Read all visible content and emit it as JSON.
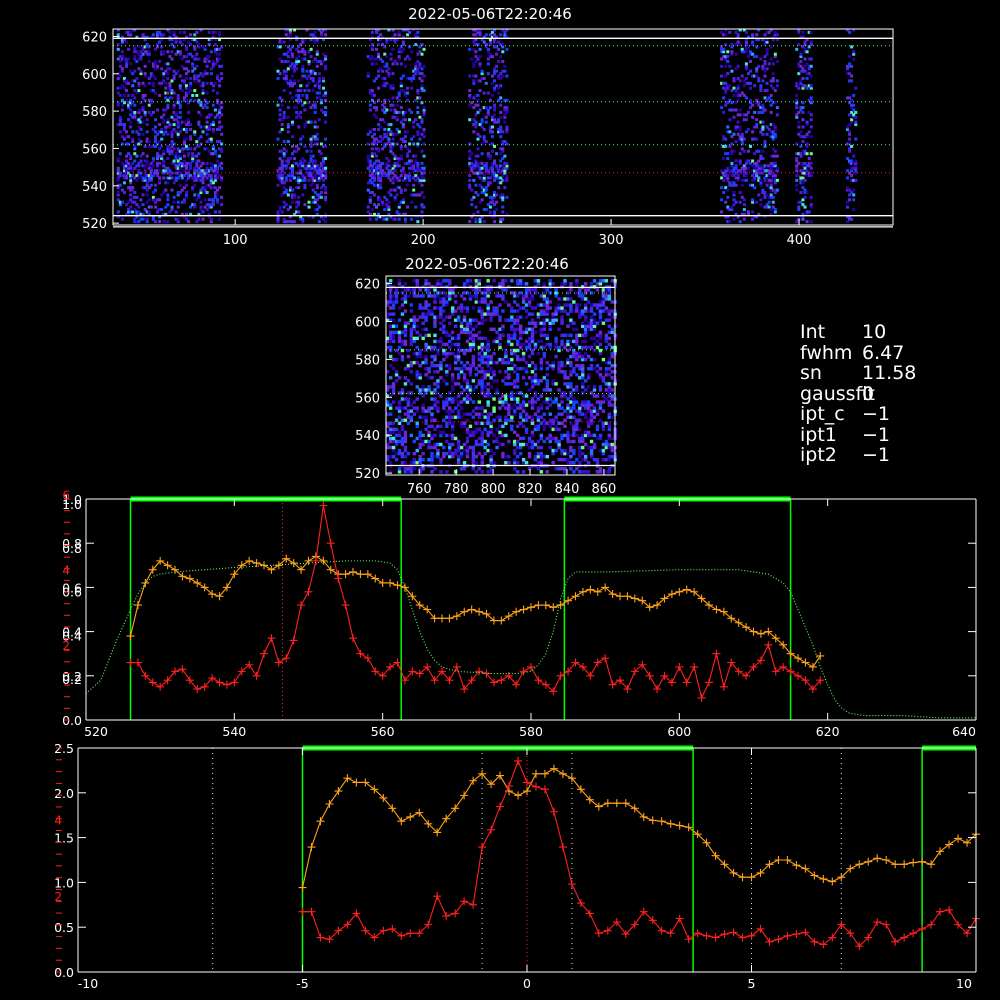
{
  "top_image": {
    "title": "2022-05-06T22:20:46",
    "xlim": [
      35,
      450
    ],
    "ylim": [
      519,
      624
    ],
    "xticks": [
      100,
      200,
      300,
      400
    ],
    "yticks": [
      520,
      540,
      560,
      580,
      600,
      620
    ],
    "hlines_white": [
      518,
      524,
      619
    ],
    "hlines_green": [
      585,
      562,
      615
    ],
    "hline_red": 547,
    "columns": [
      {
        "start": 37,
        "end": 93
      },
      {
        "start": 122,
        "end": 148
      },
      {
        "start": 170,
        "end": 200
      },
      {
        "start": 224,
        "end": 244
      },
      {
        "start": 358,
        "end": 388
      },
      {
        "start": 398,
        "end": 406
      },
      {
        "start": 425,
        "end": 430
      }
    ]
  },
  "zoom_image": {
    "title": "2022-05-06T22:20:46",
    "xlim": [
      742,
      866
    ],
    "ylim": [
      519,
      624
    ],
    "xticks": [
      760,
      780,
      800,
      820,
      840,
      860
    ],
    "yticks": [
      520,
      540,
      560,
      580,
      600,
      620
    ]
  },
  "fit_info": [
    {
      "key": "Int",
      "value": "10"
    },
    {
      "key": "fwhm",
      "value": "6.47"
    },
    {
      "key": "sn",
      "value": "11.58"
    },
    {
      "key": "gaussfit",
      "value": "0"
    },
    {
      "key": "ipt_c",
      "value": "−1"
    },
    {
      "key": "ipt1",
      "value": "−1"
    },
    {
      "key": "ipt2",
      "value": "−1"
    }
  ],
  "colors": {
    "background": "#000000",
    "axes": "#ffffff",
    "green": "#00ff00",
    "orange": "#ffa31a",
    "red": "#ff2020",
    "dotted_white": "#ffffff",
    "dotted_green": "#66ff66"
  },
  "chart_data": [
    {
      "type": "line",
      "panel": "profile",
      "xlim": [
        520,
        640
      ],
      "xticks": [
        520,
        540,
        560,
        580,
        600,
        620,
        640
      ],
      "left_axis_white": {
        "ylim": [
          0,
          1.0
        ],
        "ticks": [
          "0.0",
          "0.2",
          "0.4",
          "0.6",
          "0.8",
          "1.0"
        ]
      },
      "left_axis_white2": {
        "ticks": [
          "0.2",
          "0.4",
          "0.6",
          "0.8",
          "1.0"
        ]
      },
      "left_axis_red": {
        "ticks": [
          "2",
          "4",
          "6"
        ]
      },
      "green_windows": [
        [
          526,
          562.5
        ],
        [
          584.5,
          615
        ]
      ],
      "red_dotted_x": 546.5,
      "series": [
        {
          "color": "orange",
          "x": [
            526,
            527,
            528,
            529,
            530,
            531,
            532,
            533,
            534,
            535,
            536,
            537,
            538,
            539,
            540,
            541,
            542,
            543,
            544,
            545,
            546,
            547,
            548,
            549,
            550,
            551,
            552,
            553,
            554,
            555,
            556,
            557,
            558,
            559,
            560,
            561,
            562,
            563,
            564,
            565,
            566,
            567,
            568,
            569,
            570,
            571,
            572,
            573,
            574,
            575,
            576,
            577,
            578,
            579,
            580,
            581,
            582,
            583,
            584,
            585,
            586,
            587,
            588,
            589,
            590,
            591,
            592,
            593,
            594,
            595,
            596,
            597,
            598,
            599,
            600,
            601,
            602,
            603,
            604,
            605,
            606,
            607,
            608,
            609,
            610,
            611,
            612,
            613,
            614,
            615,
            616,
            617,
            618,
            619
          ],
          "y": [
            0.38,
            0.52,
            0.62,
            0.68,
            0.72,
            0.7,
            0.68,
            0.65,
            0.64,
            0.62,
            0.6,
            0.57,
            0.56,
            0.6,
            0.66,
            0.7,
            0.72,
            0.71,
            0.7,
            0.68,
            0.7,
            0.73,
            0.71,
            0.68,
            0.72,
            0.74,
            0.72,
            0.68,
            0.66,
            0.66,
            0.67,
            0.66,
            0.66,
            0.64,
            0.62,
            0.62,
            0.61,
            0.6,
            0.56,
            0.52,
            0.5,
            0.46,
            0.46,
            0.46,
            0.47,
            0.49,
            0.5,
            0.49,
            0.48,
            0.45,
            0.45,
            0.47,
            0.49,
            0.5,
            0.51,
            0.52,
            0.52,
            0.51,
            0.52,
            0.54,
            0.56,
            0.58,
            0.59,
            0.58,
            0.6,
            0.57,
            0.56,
            0.56,
            0.55,
            0.54,
            0.51,
            0.52,
            0.55,
            0.57,
            0.58,
            0.59,
            0.58,
            0.55,
            0.52,
            0.5,
            0.49,
            0.46,
            0.44,
            0.42,
            0.4,
            0.39,
            0.4,
            0.37,
            0.34,
            0.3,
            0.28,
            0.26,
            0.24,
            0.29
          ]
        },
        {
          "color": "red",
          "x": [
            526,
            527,
            528,
            529,
            530,
            531,
            532,
            533,
            534,
            535,
            536,
            537,
            538,
            539,
            540,
            541,
            542,
            543,
            544,
            545,
            546,
            547,
            548,
            549,
            550,
            551,
            552,
            553,
            554,
            555,
            556,
            557,
            558,
            559,
            560,
            561,
            562,
            563,
            564,
            565,
            566,
            567,
            568,
            569,
            570,
            571,
            572,
            573,
            574,
            575,
            576,
            577,
            578,
            579,
            580,
            581,
            582,
            583,
            584,
            585,
            586,
            587,
            588,
            589,
            590,
            591,
            592,
            593,
            594,
            595,
            596,
            597,
            598,
            599,
            600,
            601,
            602,
            603,
            604,
            605,
            606,
            607,
            608,
            609,
            610,
            611,
            612,
            613,
            614,
            615,
            616,
            617,
            618,
            619
          ],
          "y": [
            0.26,
            0.26,
            0.2,
            0.17,
            0.15,
            0.18,
            0.22,
            0.23,
            0.18,
            0.14,
            0.15,
            0.19,
            0.17,
            0.16,
            0.17,
            0.22,
            0.25,
            0.2,
            0.3,
            0.37,
            0.26,
            0.28,
            0.36,
            0.52,
            0.58,
            0.72,
            0.97,
            0.8,
            0.64,
            0.52,
            0.37,
            0.3,
            0.28,
            0.22,
            0.2,
            0.24,
            0.26,
            0.18,
            0.22,
            0.21,
            0.24,
            0.18,
            0.22,
            0.18,
            0.24,
            0.14,
            0.18,
            0.22,
            0.21,
            0.17,
            0.18,
            0.2,
            0.16,
            0.22,
            0.24,
            0.18,
            0.16,
            0.13,
            0.2,
            0.22,
            0.26,
            0.24,
            0.2,
            0.26,
            0.28,
            0.16,
            0.18,
            0.14,
            0.22,
            0.25,
            0.2,
            0.14,
            0.2,
            0.17,
            0.24,
            0.17,
            0.24,
            0.1,
            0.17,
            0.3,
            0.15,
            0.26,
            0.22,
            0.2,
            0.24,
            0.27,
            0.34,
            0.22,
            0.24,
            0.22,
            0.2,
            0.18,
            0.14,
            0.18
          ]
        },
        {
          "color": "dotted_green",
          "style": "dotted",
          "x": [
            520,
            522,
            524,
            526,
            527,
            528,
            529,
            530,
            532,
            540,
            545,
            550,
            555,
            559,
            561,
            562,
            563,
            564,
            565,
            566,
            567,
            568,
            570,
            575,
            578,
            580,
            581,
            582,
            583,
            584,
            585,
            586,
            590,
            600,
            608,
            612,
            614,
            615,
            616,
            617,
            618,
            619,
            620,
            621,
            622,
            623,
            625,
            630,
            635,
            640
          ],
          "y": [
            0.12,
            0.18,
            0.35,
            0.5,
            0.57,
            0.62,
            0.65,
            0.66,
            0.67,
            0.69,
            0.7,
            0.71,
            0.72,
            0.72,
            0.71,
            0.68,
            0.6,
            0.5,
            0.4,
            0.32,
            0.27,
            0.24,
            0.22,
            0.21,
            0.21,
            0.22,
            0.25,
            0.3,
            0.4,
            0.55,
            0.64,
            0.67,
            0.67,
            0.68,
            0.68,
            0.66,
            0.62,
            0.58,
            0.5,
            0.42,
            0.34,
            0.24,
            0.16,
            0.09,
            0.05,
            0.03,
            0.02,
            0.02,
            0.01,
            0.01
          ]
        }
      ]
    },
    {
      "type": "line",
      "panel": "offset",
      "xlim": [
        -10,
        10
      ],
      "xticks": [
        -10,
        -5,
        0,
        5,
        10
      ],
      "left_axis_white": {
        "ylim": [
          0,
          2.6
        ],
        "ticks": [
          "0.0",
          "0.5",
          "1.0",
          "1.5",
          "2.0",
          "2.5"
        ]
      },
      "left_axis_red": {
        "ticks": [
          "2",
          "4"
        ]
      },
      "green_windows": [
        [
          -5,
          3.7
        ],
        [
          8.8,
          10
        ]
      ],
      "dotted_white_x": [
        -7,
        -1,
        1,
        5,
        7
      ],
      "red_dotted_x": 0,
      "series": [
        {
          "color": "orange",
          "x": [
            -5.0,
            -4.8,
            -4.6,
            -4.4,
            -4.2,
            -4.0,
            -3.8,
            -3.6,
            -3.4,
            -3.2,
            -3.0,
            -2.8,
            -2.6,
            -2.4,
            -2.2,
            -2.0,
            -1.8,
            -1.6,
            -1.4,
            -1.2,
            -1.0,
            -0.8,
            -0.6,
            -0.4,
            -0.2,
            0.0,
            0.2,
            0.4,
            0.6,
            0.8,
            1.0,
            1.2,
            1.4,
            1.6,
            1.8,
            2.0,
            2.2,
            2.4,
            2.6,
            2.8,
            3.0,
            3.2,
            3.4,
            3.6,
            3.8,
            4.0,
            4.2,
            4.4,
            4.6,
            4.8,
            5.0,
            5.2,
            5.4,
            5.6,
            5.8,
            6.0,
            6.2,
            6.4,
            6.6,
            6.8,
            7.0,
            7.2,
            7.4,
            7.6,
            7.8,
            8.0,
            8.2,
            8.4,
            8.6,
            8.8,
            9.0,
            9.2,
            9.4,
            9.6,
            9.8,
            10.0
          ],
          "y": [
            0.98,
            1.45,
            1.75,
            1.95,
            2.1,
            2.25,
            2.2,
            2.2,
            2.12,
            2.02,
            1.9,
            1.75,
            1.8,
            1.85,
            1.72,
            1.62,
            1.78,
            1.9,
            2.05,
            2.22,
            2.3,
            2.18,
            2.28,
            2.1,
            2.05,
            2.1,
            2.3,
            2.3,
            2.36,
            2.3,
            2.25,
            2.12,
            2.0,
            1.92,
            1.96,
            1.96,
            1.96,
            1.9,
            1.8,
            1.76,
            1.75,
            1.72,
            1.7,
            1.68,
            1.6,
            1.5,
            1.35,
            1.25,
            1.15,
            1.1,
            1.1,
            1.15,
            1.25,
            1.3,
            1.3,
            1.24,
            1.2,
            1.12,
            1.08,
            1.05,
            1.1,
            1.2,
            1.25,
            1.28,
            1.32,
            1.3,
            1.25,
            1.25,
            1.27,
            1.28,
            1.25,
            1.4,
            1.48,
            1.55,
            1.5,
            1.6
          ]
        },
        {
          "color": "red",
          "x": [
            -5.0,
            -4.8,
            -4.6,
            -4.4,
            -4.2,
            -4.0,
            -3.8,
            -3.6,
            -3.4,
            -3.2,
            -3.0,
            -2.8,
            -2.6,
            -2.4,
            -2.2,
            -2.0,
            -1.8,
            -1.6,
            -1.4,
            -1.2,
            -1.0,
            -0.8,
            -0.6,
            -0.4,
            -0.2,
            0.0,
            0.2,
            0.4,
            0.6,
            0.8,
            1.0,
            1.2,
            1.4,
            1.6,
            1.8,
            2.0,
            2.2,
            2.4,
            2.6,
            2.8,
            3.0,
            3.2,
            3.4,
            3.6,
            3.8,
            4.0,
            4.2,
            4.4,
            4.6,
            4.8,
            5.0,
            5.2,
            5.4,
            5.6,
            5.8,
            6.0,
            6.2,
            6.4,
            6.6,
            6.8,
            7.0,
            7.2,
            7.4,
            7.6,
            7.8,
            8.0,
            8.2,
            8.4,
            8.6,
            8.8,
            9.0,
            9.2,
            9.4,
            9.6,
            9.8,
            10.0
          ],
          "y": [
            0.7,
            0.7,
            0.4,
            0.38,
            0.48,
            0.55,
            0.68,
            0.48,
            0.4,
            0.48,
            0.5,
            0.42,
            0.45,
            0.45,
            0.55,
            0.88,
            0.65,
            0.68,
            0.82,
            0.78,
            1.45,
            1.65,
            1.92,
            2.16,
            2.45,
            2.2,
            2.15,
            2.12,
            1.86,
            1.45,
            1.02,
            0.8,
            0.68,
            0.45,
            0.48,
            0.58,
            0.44,
            0.55,
            0.7,
            0.6,
            0.48,
            0.45,
            0.62,
            0.38,
            0.45,
            0.42,
            0.4,
            0.44,
            0.46,
            0.4,
            0.42,
            0.5,
            0.35,
            0.38,
            0.42,
            0.44,
            0.46,
            0.35,
            0.32,
            0.4,
            0.55,
            0.45,
            0.3,
            0.4,
            0.58,
            0.55,
            0.35,
            0.4,
            0.45,
            0.5,
            0.55,
            0.7,
            0.72,
            0.55,
            0.45,
            0.62
          ]
        }
      ]
    }
  ]
}
